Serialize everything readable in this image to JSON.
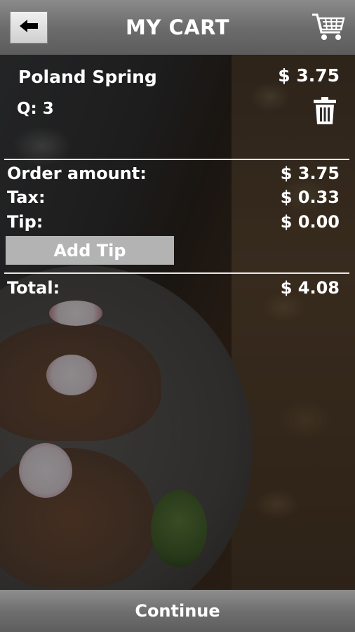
{
  "header": {
    "title": "MY CART",
    "back_icon": "arrow-left-icon",
    "cart_icon": "shopping-cart-icon"
  },
  "item": {
    "name": "Poland Spring",
    "price": "$ 3.75",
    "quantity": "Q: 3",
    "delete_icon": "trash-icon"
  },
  "summary": {
    "order_amount_label": "Order amount:",
    "order_amount_value": "$ 3.75",
    "tax_label": "Tax:",
    "tax_value": "$ 0.33",
    "tip_label": "Tip:",
    "tip_value": "$ 0.00",
    "add_tip_label": "Add Tip",
    "total_label": "Total:",
    "total_value": "$ 4.08"
  },
  "footer": {
    "continue_label": "Continue"
  },
  "colors": {
    "header_gradient_top": "#8b8b8b",
    "header_gradient_bottom": "#5c5c5c",
    "add_tip_bg": "#b3b3b3",
    "text": "#ffffff"
  }
}
